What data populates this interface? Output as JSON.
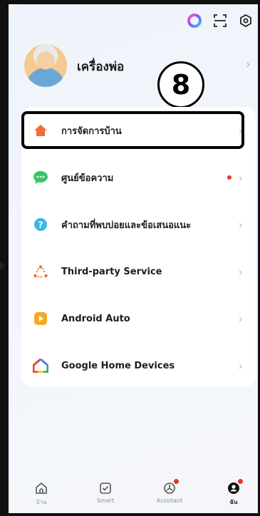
{
  "profile": {
    "name": "เครื่องพ่อ"
  },
  "annotation": {
    "step_number": "8"
  },
  "menu": {
    "items": [
      {
        "label": "การจัดการบ้าน",
        "icon": "home-icon",
        "color": "#f26a3d"
      },
      {
        "label": "ศูนย์ข้อความ",
        "icon": "message-icon",
        "color": "#3cc36a",
        "has_dot": true
      },
      {
        "label": "คำถามที่พบบ่อยและข้อเสนอแนะ",
        "icon": "help-icon",
        "color": "#3cb7e8"
      },
      {
        "label": "Third-party Service",
        "icon": "third-party-icon",
        "color": "#f26a3d"
      },
      {
        "label": "Android Auto",
        "icon": "android-auto-icon",
        "color": "#f7a823"
      },
      {
        "label": "Google Home Devices",
        "icon": "google-home-icon",
        "color": "#4285f4"
      }
    ]
  },
  "tabbar": {
    "tabs": [
      {
        "label": "บ้าน",
        "icon": "home-tab-icon",
        "active": false
      },
      {
        "label": "Smart",
        "icon": "smart-tab-icon",
        "active": false
      },
      {
        "label": "Assistant",
        "icon": "assistant-tab-icon",
        "active": false,
        "has_dot": true
      },
      {
        "label": "ฉัน",
        "icon": "me-tab-icon",
        "active": true,
        "has_dot": true
      }
    ]
  },
  "colors": {
    "accent_red": "#e5352c",
    "text_primary": "#1d1d1f"
  }
}
